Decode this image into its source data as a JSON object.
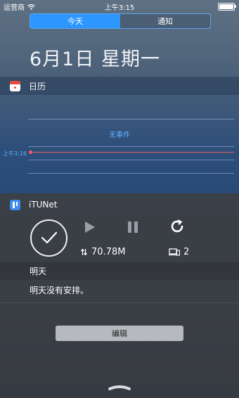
{
  "status_bar": {
    "carrier": "运营商",
    "time": "上午3:15"
  },
  "segments": [
    {
      "label": "今天",
      "active": true
    },
    {
      "label": "通知",
      "active": false
    }
  ],
  "date_heading": "6月1日  星期一",
  "calendar": {
    "title": "日历",
    "no_events": "无事件",
    "now_label": "上午3:16"
  },
  "itunet": {
    "title": "iTUNet",
    "traffic": "70.78M",
    "devices": "2",
    "icons": [
      "check-circle-icon",
      "play-icon",
      "pause-icon",
      "refresh-icon",
      "transfer-icon",
      "devices-icon"
    ]
  },
  "tomorrow": {
    "header": "明天",
    "text": "明天没有安排。"
  },
  "edit_label": "编辑",
  "colors": {
    "accent": "#2d97ff",
    "now_line": "#e86262",
    "event_text": "#5fb0ff"
  }
}
